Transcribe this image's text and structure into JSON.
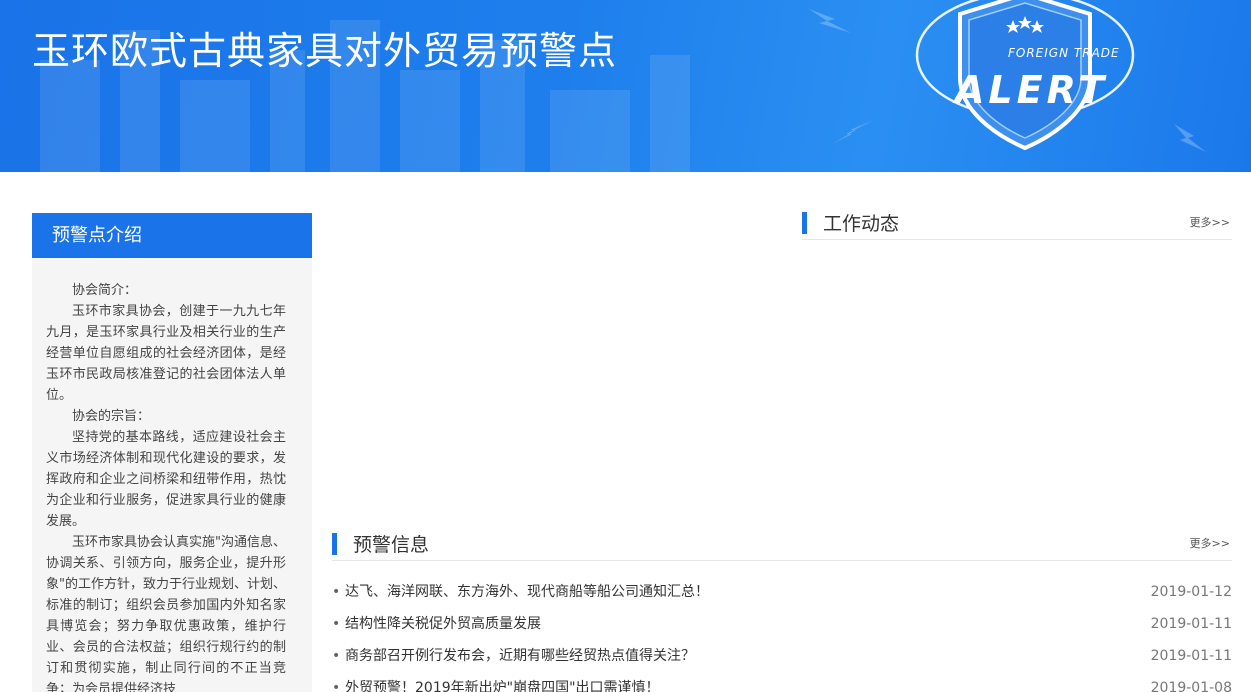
{
  "banner": {
    "title": "玉环欧式古典家具对外贸易预警点",
    "badge_top": "FOREIGN TRADE",
    "badge_main": "ALERT"
  },
  "sidebar": {
    "title": "预警点介绍",
    "paragraphs": [
      "协会简介：",
      "玉环市家具协会，创建于一九九七年九月，是玉环家具行业及相关行业的生产经营单位自愿组成的社会经济团体，是经玉环市民政局核准登记的社会团体法人单位。",
      "协会的宗旨：",
      "坚持党的基本路线，适应建设社会主义市场经济体制和现代化建设的要求，发挥政府和企业之间桥梁和纽带作用，热忱为企业和行业服务，促进家具行业的健康发展。",
      "玉环市家具协会认真实施\"沟通信息、协调关系、引领方向，服务企业，提升形象\"的工作方针，致力于行业规划、计划、标准的制订；组织会员参加国内外知名家具博览会；努力争取优惠政策，维护行业、会员的合法权益；组织行规行约的制订和贯彻实施，制止同行间的不正当竞争；为会员提供经济技"
    ]
  },
  "work_news": {
    "title": "工作动态",
    "more": "更多>>"
  },
  "alerts": {
    "title": "预警信息",
    "more": "更多>>",
    "items": [
      {
        "text": "达飞、海洋网联、东方海外、现代商船等船公司通知汇总！",
        "date": "2019-01-12"
      },
      {
        "text": "结构性降关税促外贸高质量发展",
        "date": "2019-01-11"
      },
      {
        "text": "商务部召开例行发布会，近期有哪些经贸热点值得关注？",
        "date": "2019-01-11"
      },
      {
        "text": "外贸预警！2019年新出炉\"崩盘四国\"出口需谨慎！",
        "date": "2019-01-08"
      }
    ]
  },
  "colors": {
    "brand": "#1a73e8"
  }
}
